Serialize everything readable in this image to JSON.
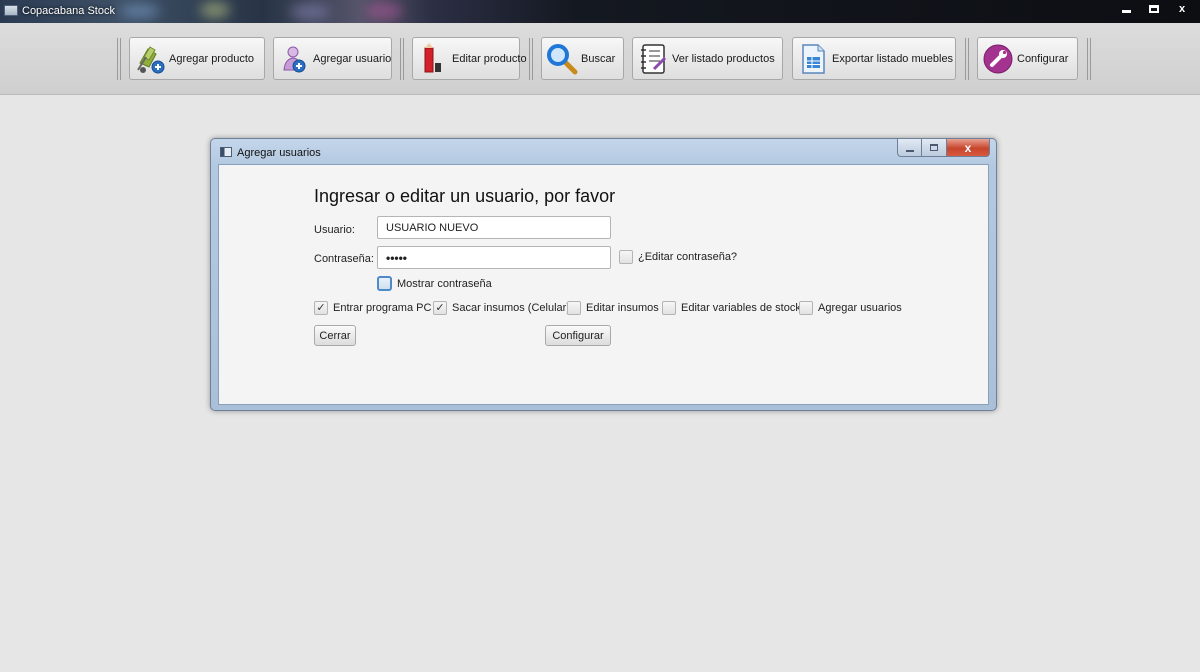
{
  "window": {
    "title": "Copacabana Stock",
    "controls": {
      "minimize": "—",
      "restore": "▫",
      "close": "x"
    }
  },
  "toolbar": {
    "items": [
      {
        "label": "Agregar producto",
        "icon": "hand-truck-add-icon"
      },
      {
        "label": "Agregar usuario",
        "icon": "add-user-icon"
      },
      {
        "label": "Editar producto",
        "icon": "pencil-edit-icon"
      },
      {
        "label": "Buscar",
        "icon": "magnifier-search-icon"
      },
      {
        "label": "Ver listado productos",
        "icon": "notebook-list-icon"
      },
      {
        "label": "Exportar listado muebles",
        "icon": "spreadsheet-export-icon"
      },
      {
        "label": "Configurar",
        "icon": "wrench-settings-icon"
      }
    ]
  },
  "dialog": {
    "title": "Agregar usuarios",
    "controls": {
      "close": "x"
    },
    "heading": "Ingresar o editar un usuario, por favor",
    "usuario_label": "Usuario:",
    "usuario_value": "USUARIO NUEVO",
    "password_label": "Contraseña:",
    "password_mask": "•••••",
    "edit_password": {
      "label": "¿Editar contraseña?",
      "checked": false
    },
    "show_password": {
      "label": "Mostrar contraseña",
      "checked": false
    },
    "permissions": [
      {
        "label": "Entrar programa PC",
        "checked": true
      },
      {
        "label": "Sacar insumos (Celular)",
        "checked": true
      },
      {
        "label": "Editar insumos",
        "checked": false
      },
      {
        "label": "Editar variables de stock",
        "checked": false
      },
      {
        "label": "Agregar usuarios",
        "checked": false
      }
    ],
    "close_button": "Cerrar",
    "configure_button": "Configurar"
  },
  "colors": {
    "background": "#e6e6e6",
    "toolbar": "#d6d6d6",
    "dialog_frame": "#b3c9e1",
    "close_red": "#c7452c",
    "focus_blue": "#4f8ac8"
  }
}
